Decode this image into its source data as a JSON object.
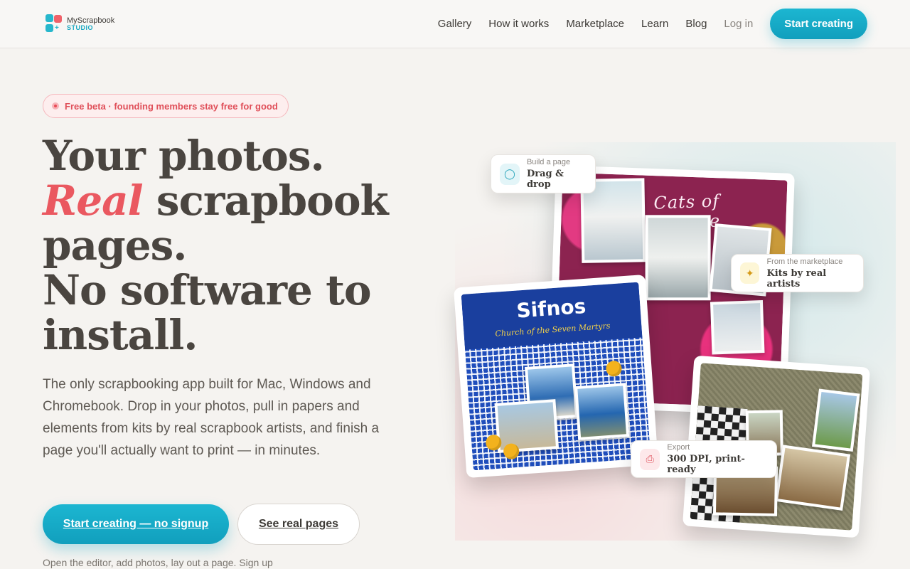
{
  "brand": {
    "name_line1": "MyScrapbook",
    "name_line2": "STUDIO",
    "colors": {
      "teal": "#1cb6d1",
      "coral": "#ea5860"
    }
  },
  "nav": {
    "items": [
      "Gallery",
      "How it works",
      "Marketplace",
      "Learn",
      "Blog"
    ],
    "login": "Log in",
    "cta": "Start creating"
  },
  "hero": {
    "badge": "Free beta · founding members stay free for good",
    "headline": {
      "line1": "Your photos.",
      "accent": "Real",
      "line2_rest": " scrapbook",
      "line3": "pages.",
      "line4": "No software to",
      "line5": "install."
    },
    "subcopy": "The only scrapbooking app built for Mac, Windows and Chromebook. Drop in your photos, pull in papers and elements from kits by real scrapbook artists, and finish a page you'll actually want to print — in minutes.",
    "primary_cta": "Start creating — no signup",
    "secondary_cta": "See real pages",
    "footnote": "Open the editor, add photos, lay out a page. Sign up"
  },
  "showcase": {
    "greece_title": "Cats of Greece",
    "sifnos_title": "Sifnos",
    "sifnos_subtitle": "Church of the Seven Martyrs",
    "chips": {
      "build": {
        "label": "Build a page",
        "value": "Drag & drop",
        "icon": "mouse-icon"
      },
      "market": {
        "label": "From the marketplace",
        "value": "Kits by real artists",
        "icon": "puzzle-icon"
      },
      "export": {
        "label": "Export",
        "value": "300 DPI, print-ready",
        "icon": "printer-icon"
      }
    }
  }
}
